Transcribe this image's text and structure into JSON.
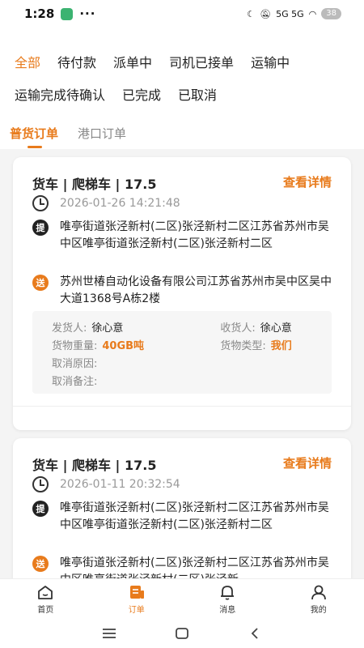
{
  "status_bar": {
    "time": "1:28",
    "dots": "···",
    "network": "5G  5G",
    "battery": "38"
  },
  "filters": {
    "row1": [
      "全部",
      "待付款",
      "派单中",
      "司机已接单",
      "运输中"
    ],
    "row2": [
      "运输完成待确认",
      "已完成",
      "已取消"
    ],
    "active": "全部"
  },
  "subtabs": {
    "tabs": [
      "普货订单",
      "港口订单"
    ],
    "active": "普货订单"
  },
  "orders": [
    {
      "vehicle": "货车 | 爬梯车 | 17.5",
      "detail_label": "查看详情",
      "time": "2026-01-26 14:21:48",
      "pickup_badge": "提",
      "pickup": "唯亭街道张泾新村(二区)张泾新村二区江苏省苏州市吴中区唯亭街道张泾新村(二区)张泾新村二区",
      "delivery_badge": "送",
      "delivery": "苏州世椿自动化设备有限公司江苏省苏州市吴中区吴中大道1368号A栋2楼",
      "info": {
        "shipper_label": "发货人:",
        "shipper": "徐心意",
        "receiver_label": "收货人:",
        "receiver": "徐心意",
        "weight_label": "货物重量:",
        "weight": "40GB吨",
        "cargo_type_label": "货物类型:",
        "cargo_type": "我们",
        "cancel_reason_label": "取消原因:",
        "cancel_reason": "",
        "cancel_note_label": "取消备注:",
        "cancel_note": ""
      }
    },
    {
      "vehicle": "货车 | 爬梯车 | 17.5",
      "detail_label": "查看详情",
      "time": "2026-01-11 20:32:54",
      "pickup_badge": "提",
      "pickup": "唯亭街道张泾新村(二区)张泾新村二区江苏省苏州市吴中区唯亭街道张泾新村(二区)张泾新村二区",
      "delivery_badge": "送",
      "delivery": "唯亭街道张泾新村(二区)张泾新村二区江苏省苏州市吴中区唯亭街道张泾新村(二区)张泾新"
    }
  ],
  "bottom_nav": [
    {
      "label": "首页",
      "icon": "home-icon"
    },
    {
      "label": "订单",
      "icon": "order-icon"
    },
    {
      "label": "消息",
      "icon": "bell-icon"
    },
    {
      "label": "我的",
      "icon": "user-icon"
    }
  ],
  "bottom_nav_active": "订单",
  "colors": {
    "accent": "#e87b1c",
    "background": "#f4f4f4"
  }
}
